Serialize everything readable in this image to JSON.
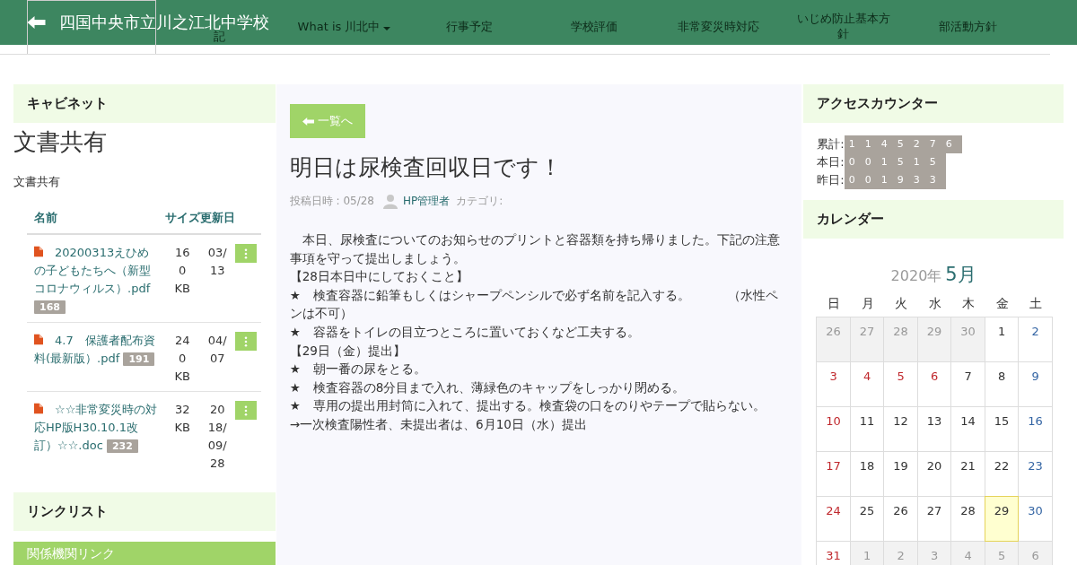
{
  "header": {
    "title": "四国中央市立川之江北中学校"
  },
  "nav": [
    {
      "label": "記",
      "dropdown": false
    },
    {
      "label": "What is 川北中",
      "dropdown": true
    },
    {
      "label": "行事予定",
      "dropdown": false
    },
    {
      "label": "学校評価",
      "dropdown": false
    },
    {
      "label": "非常変災時対応",
      "dropdown": false
    },
    {
      "label": "いじめ防止基本方針",
      "dropdown": false
    },
    {
      "label": "部活動方針",
      "dropdown": false
    }
  ],
  "cabinet": {
    "heading": "キャビネット",
    "title": "文書共有",
    "description": "文書共有",
    "columns": [
      "名前",
      "サイズ",
      "更新日"
    ],
    "files": [
      {
        "name": "　20200313えひめの子どもたちへ（新型コロナウィルス）.pdf",
        "count": "168",
        "size": "160 KB",
        "date": "03/13"
      },
      {
        "name": "　4.7　保護者配布資料(最新版）.pdf",
        "count": "191",
        "size": "240 KB",
        "date": "04/07"
      },
      {
        "name": "　☆☆非常変災時の対応HP版H30.10.1改訂）☆☆.doc",
        "count": "232",
        "size": "32 KB",
        "date": "2018/09/28"
      }
    ]
  },
  "linklist": {
    "heading": "リンクリスト",
    "category": "関係機関リンク"
  },
  "post": {
    "back_button": "一覧へ",
    "title": "明日は尿検査回収日です！",
    "meta_date": "投稿日時 : 05/28",
    "author": "HP管理者",
    "category_label": "カテゴリ:",
    "body": [
      "　本日、尿検査についてのお知らせのプリントと容器類を持ち帰りました。下記の注意事項を守って提出しましょう。",
      "【28日本日中にしておくこと】",
      "★　検査容器に鉛筆もしくはシャープペンシルで必ず名前を記入する。　　　（水性ペンは不可）",
      "★　容器をトイレの目立つところに置いておくなど工夫する。",
      "【29日（金）提出】",
      "★　朝一番の尿をとる。",
      "★　検査容器の8分目まで入れ、薄緑色のキャップをしっかり閉める。",
      "★　専用の提出用封筒に入れて、提出する。検査袋の口をのりやテープで貼らない。",
      "→一次検査陽性者、未提出者は、6月10日（水）提出"
    ]
  },
  "counter": {
    "heading": "アクセスカウンター",
    "rows": [
      {
        "label": "累計:",
        "digits": "1145276"
      },
      {
        "label": "本日:",
        "digits": "001515"
      },
      {
        "label": "昨日:",
        "digits": "001933"
      }
    ]
  },
  "calendar": {
    "heading": "カレンダー",
    "year": "2020年",
    "month": "5月",
    "weekdays": [
      "日",
      "月",
      "火",
      "水",
      "木",
      "金",
      "土"
    ],
    "days": [
      {
        "day": "26",
        "kind": "other"
      },
      {
        "day": "27",
        "kind": "other"
      },
      {
        "day": "28",
        "kind": "other"
      },
      {
        "day": "29",
        "kind": "other"
      },
      {
        "day": "30",
        "kind": "other"
      },
      {
        "day": "1",
        "kind": "weekday"
      },
      {
        "day": "2",
        "kind": "saturday"
      },
      {
        "day": "3",
        "kind": "sunday"
      },
      {
        "day": "4",
        "kind": "holiday"
      },
      {
        "day": "5",
        "kind": "holiday"
      },
      {
        "day": "6",
        "kind": "holiday"
      },
      {
        "day": "7",
        "kind": "weekday"
      },
      {
        "day": "8",
        "kind": "weekday"
      },
      {
        "day": "9",
        "kind": "saturday"
      },
      {
        "day": "10",
        "kind": "sunday"
      },
      {
        "day": "11",
        "kind": "weekday"
      },
      {
        "day": "12",
        "kind": "weekday"
      },
      {
        "day": "13",
        "kind": "weekday"
      },
      {
        "day": "14",
        "kind": "weekday"
      },
      {
        "day": "15",
        "kind": "weekday"
      },
      {
        "day": "16",
        "kind": "saturday"
      },
      {
        "day": "17",
        "kind": "sunday"
      },
      {
        "day": "18",
        "kind": "weekday"
      },
      {
        "day": "19",
        "kind": "weekday"
      },
      {
        "day": "20",
        "kind": "weekday"
      },
      {
        "day": "21",
        "kind": "weekday"
      },
      {
        "day": "22",
        "kind": "weekday"
      },
      {
        "day": "23",
        "kind": "saturday"
      },
      {
        "day": "24",
        "kind": "sunday"
      },
      {
        "day": "25",
        "kind": "weekday"
      },
      {
        "day": "26",
        "kind": "weekday"
      },
      {
        "day": "27",
        "kind": "weekday"
      },
      {
        "day": "28",
        "kind": "weekday"
      },
      {
        "day": "29",
        "kind": "today"
      },
      {
        "day": "30",
        "kind": "saturday"
      },
      {
        "day": "31",
        "kind": "sunday"
      },
      {
        "day": "1",
        "kind": "other"
      },
      {
        "day": "2",
        "kind": "other"
      },
      {
        "day": "3",
        "kind": "other"
      },
      {
        "day": "4",
        "kind": "other"
      },
      {
        "day": "5",
        "kind": "other"
      },
      {
        "day": "6",
        "kind": "other"
      }
    ]
  }
}
